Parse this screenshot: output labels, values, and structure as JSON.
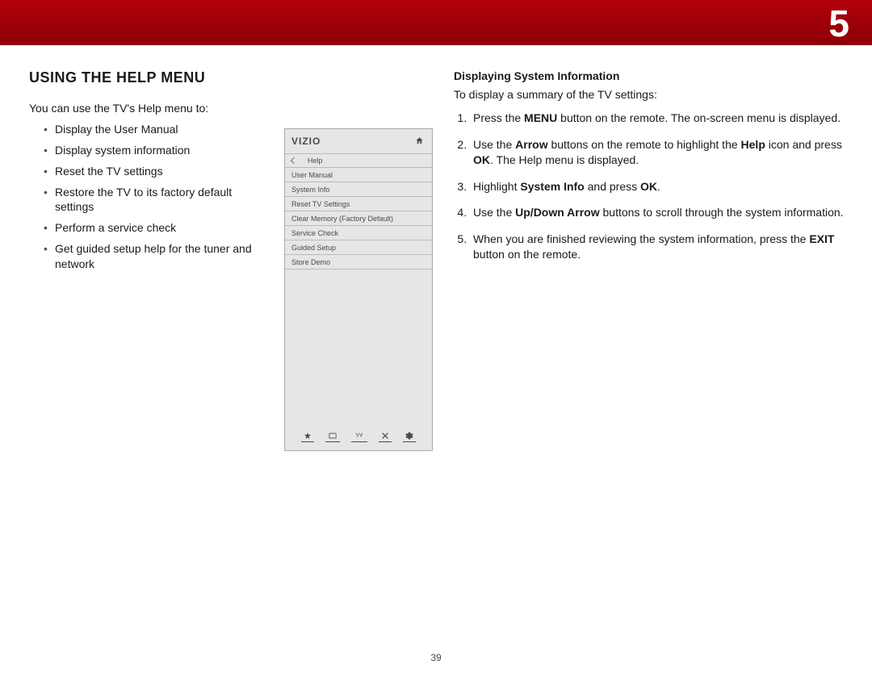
{
  "chapter_number": "5",
  "page_number": "39",
  "section_title": "USING THE HELP MENU",
  "intro": "You can use the TV's Help menu to:",
  "bullets": [
    "Display the User Manual",
    "Display system information",
    "Reset the TV settings",
    "Restore the TV to its factory default settings",
    "Perform a service check",
    "Get guided setup help for the tuner and network"
  ],
  "sub_heading": "Displaying System Information",
  "sub_lead": "To display a summary of the TV settings:",
  "steps": [
    {
      "pre": "Press the ",
      "b1": "MENU",
      "mid": " button on the remote. The on-screen menu is displayed."
    },
    {
      "pre": "Use the ",
      "b1": "Arrow",
      "mid": " buttons on the remote to highlight the ",
      "b2": "Help",
      "post": " icon and press ",
      "b3": "OK",
      "end": ". The Help menu is displayed."
    },
    {
      "pre": "Highlight ",
      "b1": "System Info",
      "mid": " and press ",
      "b2": "OK",
      "post": "."
    },
    {
      "pre": "Use the ",
      "b1": "Up/Down Arrow",
      "mid": " buttons to scroll through the system information."
    },
    {
      "pre": "When you are finished reviewing the system information, press the ",
      "b1": "EXIT",
      "mid": " button on the remote."
    }
  ],
  "menu": {
    "brand": "VIZIO",
    "title": "Help",
    "items": [
      "User Manual",
      "System Info",
      "Reset TV Settings",
      "Clear Memory (Factory Default)",
      "Service Check",
      "Guided Setup",
      "Store Demo"
    ]
  }
}
